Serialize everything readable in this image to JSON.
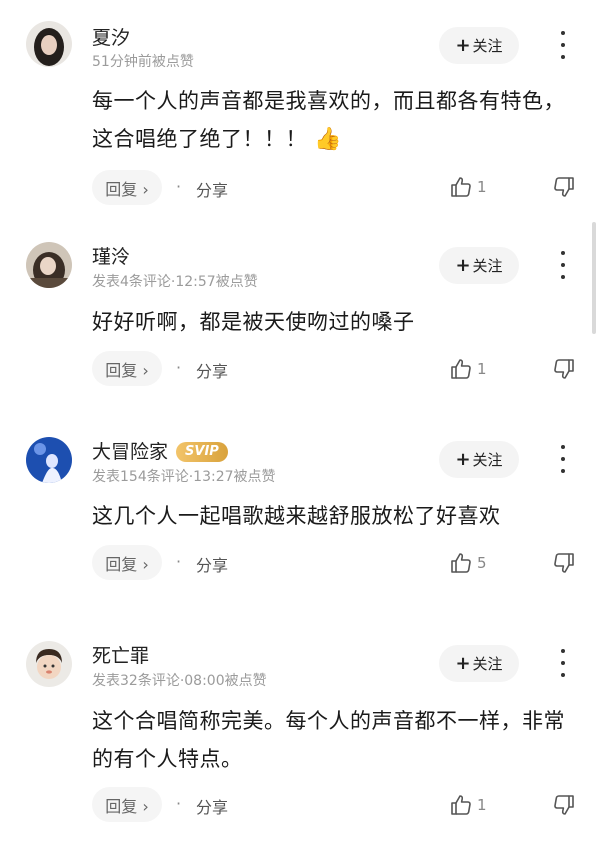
{
  "comments": [
    {
      "username": "夏汐",
      "meta": "51分钟前被点赞",
      "follow_label": "关注",
      "text": "每一个人的声音都是我喜欢的，而且都各有特色，这合唱绝了绝了！！！",
      "emoji": "👍",
      "reply_label": "回复 ›",
      "share_label": "分享",
      "likes": "1",
      "badge": ""
    },
    {
      "username": "瑾泠",
      "meta": "发表4条评论·12:57被点赞",
      "follow_label": "关注",
      "text": "好好听啊，都是被天使吻过的嗓子",
      "reply_label": "回复 ›",
      "share_label": "分享",
      "likes": "1",
      "badge": ""
    },
    {
      "username": "大冒险家",
      "meta": "发表154条评论·13:27被点赞",
      "follow_label": "关注",
      "text": "这几个人一起唱歌越来越舒服放松了好喜欢",
      "reply_label": "回复 ›",
      "share_label": "分享",
      "likes": "5",
      "badge": "SVIP"
    },
    {
      "username": "死亡罪",
      "meta": "发表32条评论·08:00被点赞",
      "follow_label": "关注",
      "text": "这个合唱简称完美。每个人的声音都不一样，非常的有个人特点。",
      "reply_label": "回复 ›",
      "share_label": "分享",
      "likes": "1",
      "badge": ""
    }
  ],
  "dot_separator": "·",
  "plus_sign": "+",
  "icons": {
    "like": "thumbs-up-icon",
    "dislike": "thumbs-down-icon",
    "more": "more-vertical-icon"
  },
  "colors": {
    "svip_gold": "#e0ad4c",
    "button_bg": "#f4f4f4",
    "meta_text": "#9b9b9b"
  }
}
